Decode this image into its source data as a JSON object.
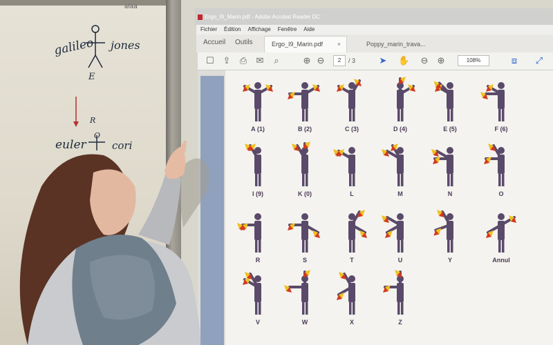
{
  "whiteboard": {
    "brand": "alaa",
    "words": [
      "galileo",
      "jones",
      "E",
      "R",
      "euler",
      "O",
      "cori"
    ]
  },
  "screen": {
    "window_title": "Ergo_I9_Marin.pdf - Adobe Acrobat Reader DC",
    "menu": [
      "Fichier",
      "Édition",
      "Affichage",
      "Fenêtre",
      "Aide"
    ],
    "tabs": {
      "home": "Accueil",
      "tools": "Outils"
    },
    "doc_tabs": [
      "Ergo_I9_Marin.pdf",
      "Poppy_marin_trava..."
    ],
    "toolbar": {
      "page_current": "2",
      "page_total": "/ 3",
      "zoom": "108%"
    },
    "figure_labels": [
      "A (1)",
      "B (2)",
      "C (3)",
      "D (4)",
      "E (5)",
      "F (6)",
      "I (9)",
      "K (0)",
      "L",
      "M",
      "N",
      "O",
      "R",
      "S",
      "T",
      "U",
      "Y",
      "Annul",
      "V",
      "W",
      "X",
      "Z"
    ]
  },
  "colors": {
    "flag_yellow": "#f0c020",
    "flag_red": "#d23a1e",
    "figure": "#5a4a6a"
  }
}
